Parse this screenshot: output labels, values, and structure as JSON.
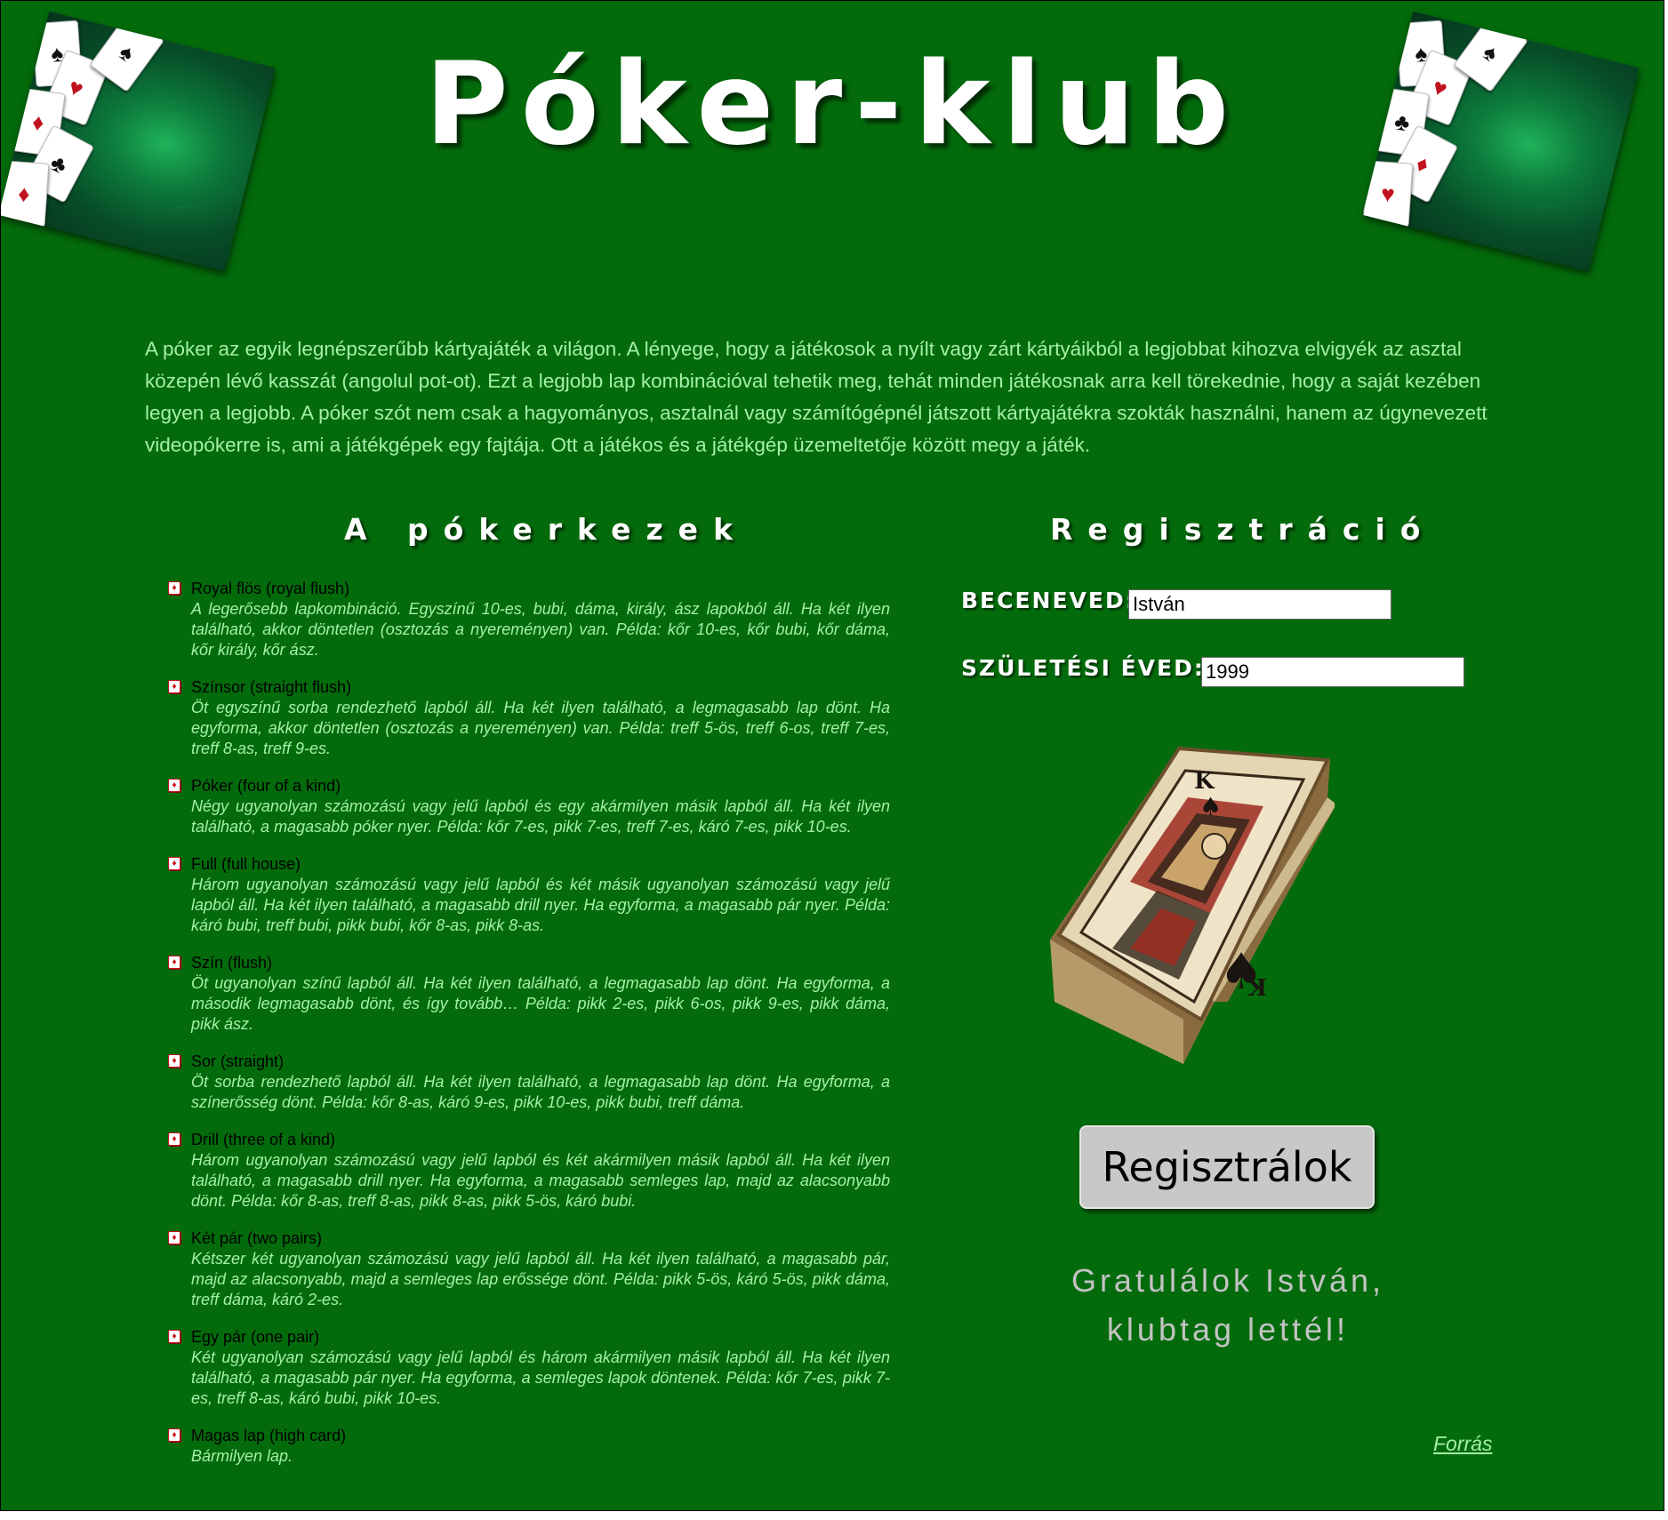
{
  "title": "Póker-klub",
  "intro": "A póker az egyik legnépszerűbb kártyajáték a világon. A lényege, hogy a játékosok a nyílt vagy zárt kártyáikból a legjobbat kihozva elvigyék az asztal közepén lévő kasszát (angolul pot-ot). Ezt a legjobb lap kombinációval tehetik meg, tehát minden játékosnak arra kell törekednie, hogy a saját kezében legyen a legjobb. A póker szót nem csak a hagyományos, asztalnál vagy számítógépnél játszott kártyajátékra szokták használni, hanem az úgynevezett videopókerre is, ami a játékgépek egy fajtája. Ott a játékos és a játékgép üzemeltetője között megy a játék.",
  "hands": {
    "heading": "A pókerkezek",
    "items": [
      {
        "name": "Royal flös (royal flush)",
        "desc": "A legerősebb lapkombináció. Egyszínű 10-es, bubi, dáma, király, ász lapokból áll. Ha két ilyen található, akkor döntetlen (osztozás a nyereményen) van. Példa: kőr 10-es, kőr bubi, kőr dáma, kőr király, kőr ász."
      },
      {
        "name": "Színsor (straight flush)",
        "desc": "Öt egyszínű sorba rendezhető lapból áll. Ha két ilyen található, a legmagasabb lap dönt. Ha egyforma, akkor döntetlen (osztozás a nyereményen) van. Példa: treff 5-ös, treff 6-os, treff 7-es, treff 8-as, treff 9-es."
      },
      {
        "name": "Póker (four of a kind)",
        "desc": "Négy ugyanolyan számozású vagy jelű lapból és egy akármilyen másik lapból áll. Ha két ilyen található, a magasabb póker nyer. Példa: kőr 7-es, pikk 7-es, treff 7-es, káró 7-es, pikk 10-es."
      },
      {
        "name": "Full (full house)",
        "desc": "Három ugyanolyan számozású vagy jelű lapból és két másik ugyanolyan számozású vagy jelű lapból áll. Ha két ilyen található, a magasabb drill nyer. Ha egyforma, a magasabb pár nyer. Példa: káró bubi, treff bubi, pikk bubi, kőr 8-as, pikk 8-as."
      },
      {
        "name": "Szín (flush)",
        "desc": "Öt ugyanolyan színű lapból áll. Ha két ilyen található, a legmagasabb lap dönt. Ha egyforma, a második legmagasabb dönt, és így tovább… Példa: pikk 2-es, pikk 6-os, pikk 9-es, pikk dáma, pikk ász."
      },
      {
        "name": "Sor (straight)",
        "desc": "Öt sorba rendezhető lapból áll. Ha két ilyen található, a legmagasabb lap dönt. Ha egyforma, a színerősség dönt. Példa: kőr 8-as, káró 9-es, pikk 10-es, pikk bubi, treff dáma."
      },
      {
        "name": "Drill (three of a kind)",
        "desc": "Három ugyanolyan számozású vagy jelű lapból és két akármilyen másik lapból áll. Ha két ilyen található, a magasabb drill nyer. Ha egyforma, a magasabb semleges lap, majd az alacsonyabb dönt. Példa: kőr 8-as, treff 8-as, pikk 8-as, pikk 5-ös, káró bubi."
      },
      {
        "name": "Két pár (two pairs)",
        "desc": "Kétszer két ugyanolyan számozású vagy jelű lapból áll. Ha két ilyen található, a magasabb pár, majd az alacsonyabb, majd a semleges lap erőssége dönt. Példa: pikk 5-ös, káró 5-ös, pikk dáma, treff dáma, káró 2-es."
      },
      {
        "name": "Egy pár (one pair)",
        "desc": "Két ugyanolyan számozású vagy jelű lapból és három akármilyen másik lapból áll. Ha két ilyen található, a magasabb pár nyer. Ha egyforma, a semleges lapok döntenek. Példa: kőr 7-es, pikk 7-es, treff 8-as, káró bubi, pikk 10-es."
      },
      {
        "name": "Magas lap (high card)",
        "desc": "Bármilyen lap."
      }
    ]
  },
  "registration": {
    "heading": "Regisztráció",
    "nickname_label": "Beceneved:",
    "nickname_value": "István",
    "birthyear_label": "Születési éved:",
    "birthyear_value": "1999",
    "button_label": "Regisztrálok",
    "success_line1": "Gratulálok István,",
    "success_line2": "klubtag lettél!"
  },
  "source_link": "Forrás",
  "colors": {
    "background": "#036b0b",
    "text_light_green": "#a4f0a7",
    "heading_white": "#ffffff",
    "hand_name": "#000000",
    "success_gray": "#c3c3c3",
    "button_gray": "#c8c8c8"
  },
  "icons": {
    "bullet": "card-bullet-icon",
    "corner_images": "poker-table-cards-image",
    "book_image": "king-of-spades-book-image"
  }
}
